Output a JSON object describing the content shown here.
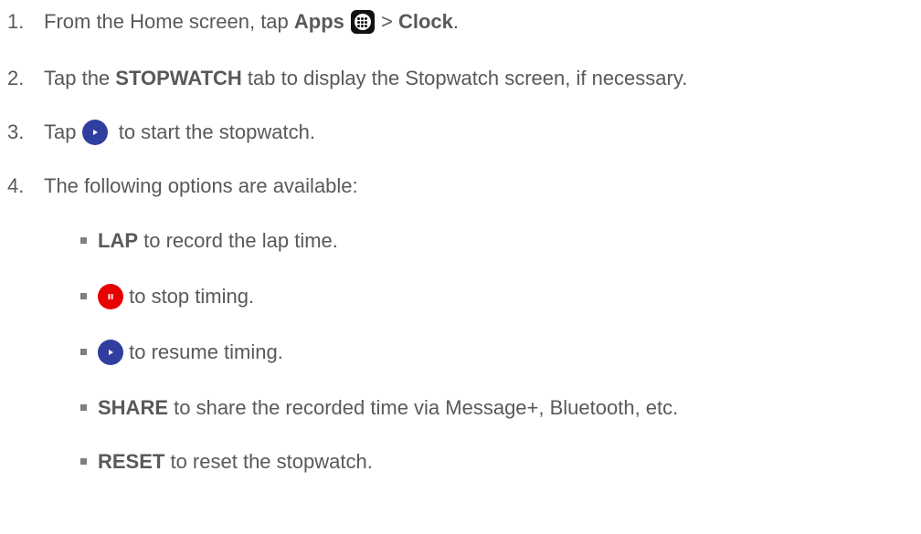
{
  "steps": [
    {
      "num": "1.",
      "prefix": "From the Home screen, tap ",
      "bold1": "Apps",
      "sep": " > ",
      "bold2": "Clock",
      "suffix": "."
    },
    {
      "num": "2.",
      "prefix": "Tap the ",
      "bold": "STOPWATCH",
      "suffix": " tab to display the Stopwatch screen, if necessary."
    },
    {
      "num": "3.",
      "prefix": "Tap ",
      "suffix": " to start the stopwatch."
    },
    {
      "num": "4.",
      "text": "The following options are available:"
    }
  ],
  "options": [
    {
      "bold": "LAP",
      "text": " to record the lap time."
    },
    {
      "icon": "pause-icon",
      "text": " to stop timing."
    },
    {
      "icon": "play-icon",
      "text": " to resume timing."
    },
    {
      "bold": "SHARE",
      "text": " to share the recorded time via Message+, Bluetooth, etc."
    },
    {
      "bold": "RESET",
      "text": " to reset the stopwatch."
    }
  ],
  "colors": {
    "text": "#595959",
    "play_blue": "#303F9F",
    "pause_red": "#E80000",
    "bullet": "#7F7F7F"
  },
  "icons": {
    "apps": "apps-grid-icon",
    "play": "play-icon",
    "pause": "pause-icon"
  }
}
